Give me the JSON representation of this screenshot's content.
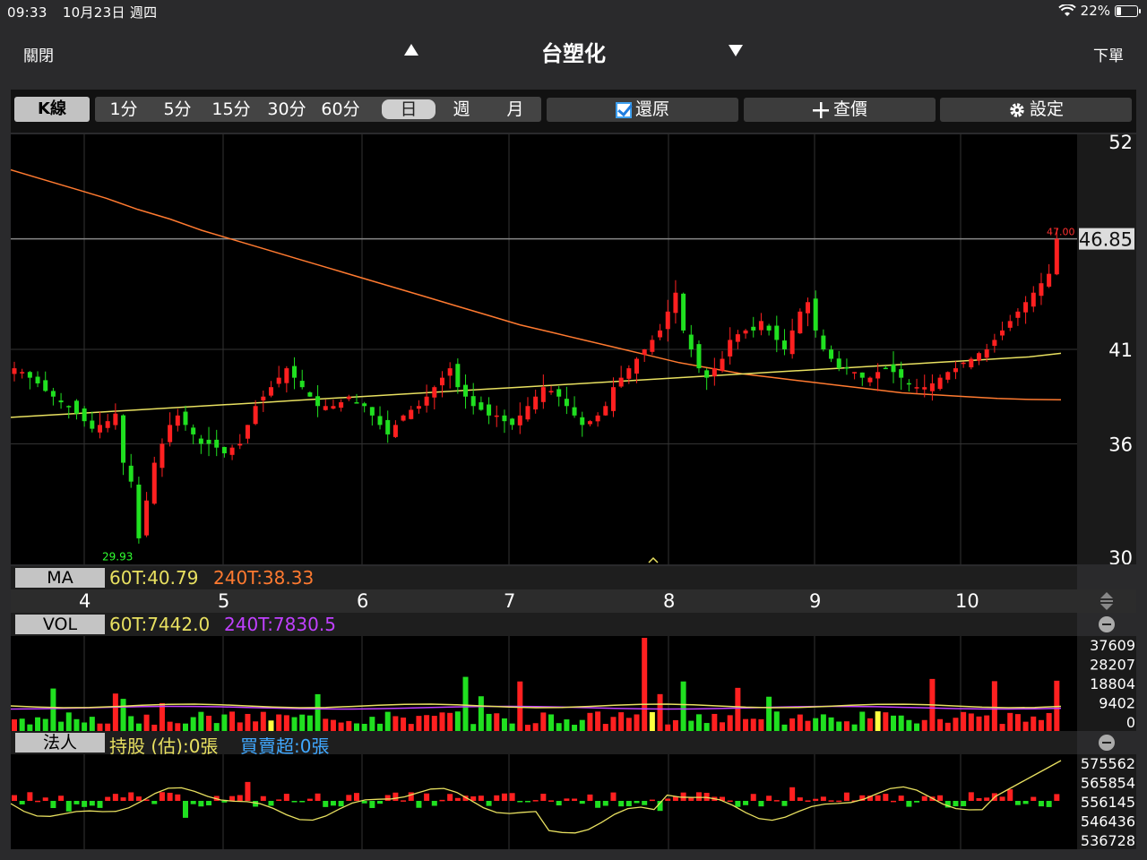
{
  "status_bar": {
    "time": "09:33",
    "date": "10月23日 週四",
    "battery": "22%",
    "battery_level": 0.22
  },
  "nav": {
    "close_label": "關閉",
    "title": "台塑化",
    "order_label": "下單"
  },
  "toolbar": {
    "k_label": "K線",
    "periods": [
      "1分",
      "5分",
      "15分",
      "30分",
      "60分",
      "日",
      "週",
      "月"
    ],
    "active_period": "日",
    "restore_label": "還原",
    "query_label": "查價",
    "settings_label": "設定"
  },
  "price_axis": {
    "ticks": [
      "52",
      "46.85",
      "41",
      "36",
      "30"
    ],
    "current": "46.85",
    "high_label": "47.00",
    "low_label": "29.93"
  },
  "ma_strip": {
    "label": "MA",
    "ma60": "60T:40.79",
    "ma240": "240T:38.33"
  },
  "date_axis": [
    "4",
    "5",
    "6",
    "7",
    "8",
    "9",
    "10"
  ],
  "vol_strip": {
    "label": "VOL",
    "ma60": "60T:7442.0",
    "ma240": "240T:7830.5"
  },
  "vol_axis": [
    "37609",
    "28207",
    "18804",
    "9402",
    "0"
  ],
  "inst_strip": {
    "label": "法人",
    "holding": "持股 (估):0張",
    "net": "買賣超:0張"
  },
  "inst_axis": [
    "575562",
    "565854",
    "556145",
    "546436",
    "536728"
  ],
  "colors": {
    "up": "#ff2020",
    "down": "#20e020",
    "ma60": "#e8e060",
    "ma240": "#ff7a30",
    "vol_ma": "#c040ff"
  },
  "chart_data": {
    "type": "candlestick",
    "price_ylim": [
      30,
      52
    ],
    "closes": [
      40.0,
      39.8,
      39.5,
      39.2,
      38.8,
      38.5,
      38.2,
      38.0,
      37.6,
      37.2,
      36.8,
      37.0,
      37.2,
      37.6,
      35.0,
      34.0,
      31.0,
      33.0,
      35.0,
      36.0,
      37.0,
      37.5,
      37.0,
      36.5,
      36.0,
      36.0,
      35.8,
      35.5,
      35.8,
      36.0,
      37.0,
      38.0,
      38.5,
      39.0,
      39.5,
      40.0,
      39.5,
      39.0,
      38.5,
      38.0,
      38.0,
      38.0,
      38.2,
      38.5,
      38.2,
      38.0,
      37.5,
      37.0,
      36.5,
      37.0,
      37.5,
      37.8,
      38.0,
      38.5,
      39.0,
      39.5,
      40.0,
      39.0,
      38.5,
      38.0,
      37.8,
      37.5,
      37.5,
      37.2,
      37.0,
      37.5,
      38.0,
      38.5,
      39.0,
      38.8,
      38.5,
      38.0,
      37.5,
      37.0,
      37.2,
      37.5,
      38.0,
      39.0,
      39.5,
      40.0,
      40.5,
      41.0,
      41.5,
      42.0,
      43.0,
      44.0,
      42.0,
      41.0,
      40.0,
      39.5,
      40.0,
      40.5,
      41.5,
      41.8,
      42.0,
      42.0,
      42.5,
      42.0,
      41.5,
      41.0,
      42.0,
      43.0,
      43.5,
      42.0,
      41.0,
      40.5,
      40.0,
      40.0,
      39.8,
      39.5,
      39.5,
      39.8,
      40.0,
      39.8,
      39.5,
      39.2,
      39.0,
      39.0,
      39.2,
      39.5,
      39.8,
      40.0,
      40.3,
      40.5,
      40.8,
      41.0,
      41.5,
      42.0,
      42.5,
      43.0,
      43.5,
      44.0,
      44.5,
      45.0,
      46.85
    ],
    "ma60_closes": [
      37.4,
      37.5,
      37.6,
      37.7,
      37.8,
      37.9,
      38.0,
      38.1,
      38.2,
      38.3,
      38.4,
      38.5,
      38.6,
      38.7,
      38.8,
      38.9,
      39.0,
      39.1,
      39.2,
      39.3,
      39.4,
      39.5,
      39.6,
      39.7,
      39.8,
      39.9,
      40.0,
      40.1,
      40.2,
      40.3,
      40.4,
      40.5,
      40.6,
      40.79
    ],
    "ma240_closes": [
      50.5,
      50.0,
      49.5,
      49.0,
      48.4,
      47.9,
      47.3,
      46.8,
      46.3,
      45.8,
      45.3,
      44.8,
      44.3,
      43.8,
      43.3,
      42.8,
      42.3,
      41.9,
      41.5,
      41.1,
      40.7,
      40.3,
      40.0,
      39.7,
      39.5,
      39.3,
      39.1,
      38.9,
      38.7,
      38.6,
      38.5,
      38.4,
      38.35,
      38.33
    ],
    "volume_ylim": [
      0,
      37609
    ],
    "inst_ylim": [
      536728,
      575562
    ]
  }
}
